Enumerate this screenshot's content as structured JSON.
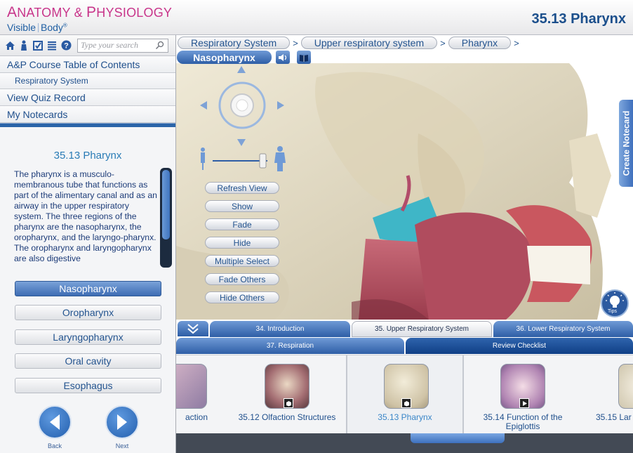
{
  "header": {
    "logo_line1_cap_a": "A",
    "logo_line1_rest_a": "NATOMY",
    "logo_line1_amp": " & ",
    "logo_line1_cap_b": "P",
    "logo_line1_rest_b": "HYSIOLOGY",
    "logo_line2_a": "Visible",
    "logo_line2_b": "Body",
    "logo_reg": "®",
    "title": "35.13 Pharynx"
  },
  "toolbar": {
    "search_placeholder": "Type your search"
  },
  "sidebar": {
    "menu": [
      {
        "label": "A&P Course Table of Contents"
      },
      {
        "label": "Respiratory System"
      },
      {
        "label": "View Quiz Record"
      },
      {
        "label": "My Notecards"
      }
    ],
    "desc_title": "35.13 Pharynx",
    "desc_text": "The pharynx is a musculo-membranous tube that functions as part of the alimentary canal and as an airway in the upper respiratory system. The three regions of the pharynx are the nasopharynx, the oropharynx, and the laryngo-pharynx. The oropharynx and laryngopharynx are also digestive",
    "scroll_fraction": 0.73,
    "regions": [
      {
        "label": "Nasopharynx",
        "active": true
      },
      {
        "label": "Oropharynx"
      },
      {
        "label": "Laryngopharynx"
      },
      {
        "label": "Oral cavity"
      },
      {
        "label": "Esophagus"
      }
    ],
    "back_label": "Back",
    "next_label": "Next"
  },
  "viewer": {
    "breadcrumbs": [
      "Respiratory System",
      "Upper respiratory system",
      "Pharynx"
    ],
    "separator": ">",
    "active_structure": "Nasopharynx",
    "controls": [
      "Refresh View",
      "Show",
      "Fade",
      "Hide",
      "Multiple Select",
      "Fade Others",
      "Hide Others"
    ],
    "create_notecard": "Create Notecard",
    "tips_label": "Tips"
  },
  "chapters": {
    "row1": [
      "34. Introduction",
      "35. Upper Respiratory System",
      "36. Lower Respiratory System"
    ],
    "row2": [
      "37. Respiration",
      "Review Checklist"
    ]
  },
  "thumbnails": [
    {
      "label": "action"
    },
    {
      "label": "35.12 Olfaction Structures"
    },
    {
      "label": "35.13 Pharynx",
      "selected": true
    },
    {
      "label": "35.14 Function of the Epiglottis"
    },
    {
      "label": "35.15 Lar"
    }
  ],
  "colors": {
    "brand_pink": "#c8358a",
    "brand_blue": "#1b4f8c",
    "accent_blue": "#2e5ea6"
  }
}
